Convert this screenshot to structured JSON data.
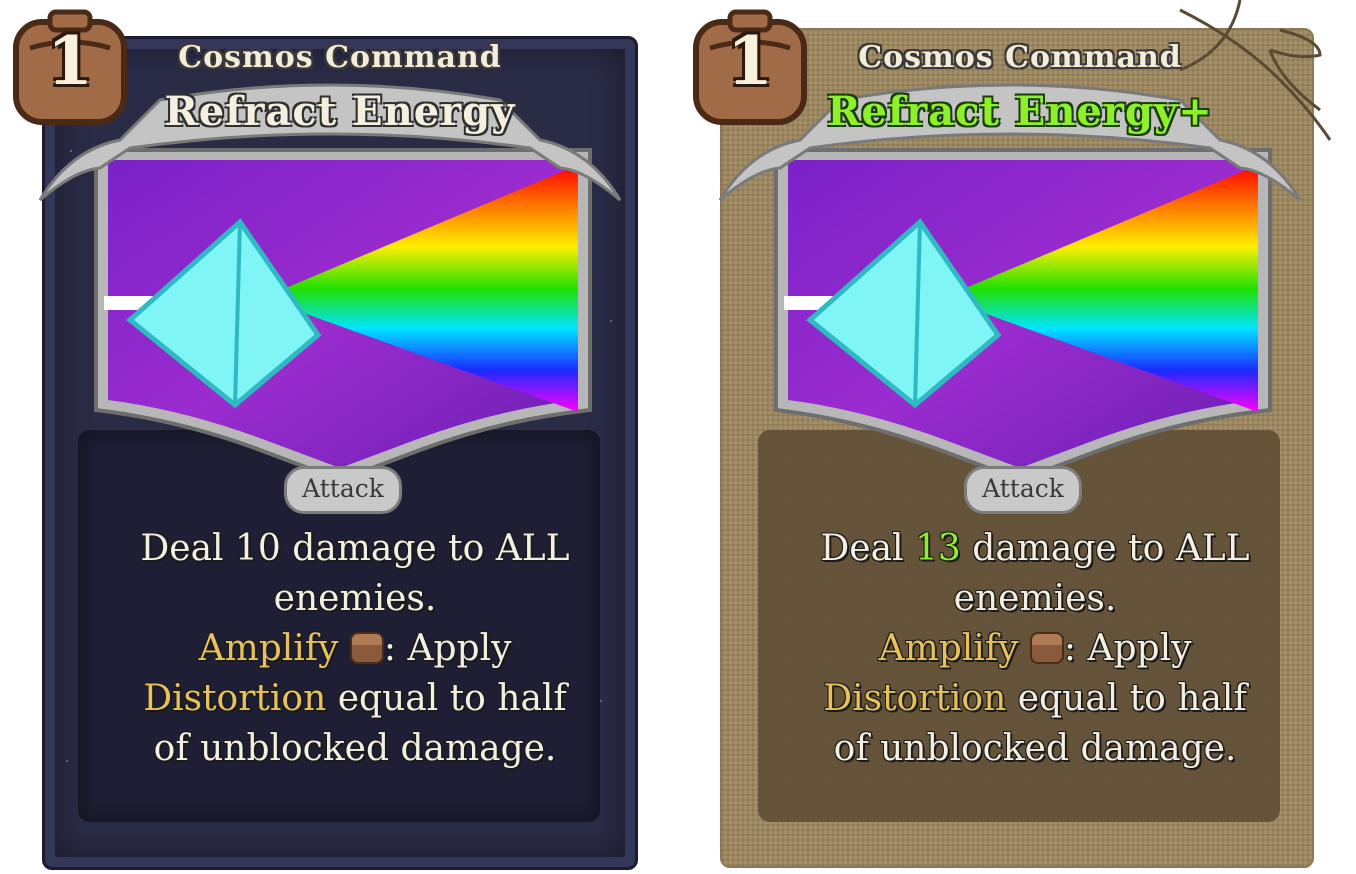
{
  "cards": [
    {
      "variant": "base",
      "cost": "1",
      "type_line": "Cosmos Command",
      "title": "Refract Energy",
      "card_kind": "Attack",
      "desc": {
        "line1_pre": "Deal ",
        "damage": "10",
        "line1_post": " damage to ALL",
        "line2": "enemies.",
        "amplify": "Amplify",
        "apply": ": Apply",
        "distortion": "Distortion",
        "rest1": " equal to half",
        "rest2": "of unblocked damage."
      }
    },
    {
      "variant": "upgraded",
      "cost": "1",
      "type_line": "Cosmos Command",
      "title": "Refract Energy+",
      "card_kind": "Attack",
      "desc": {
        "line1_pre": "Deal ",
        "damage": "13",
        "line1_post": " damage to ALL",
        "line2": "enemies.",
        "amplify": "Amplify",
        "apply": ": Apply",
        "distortion": "Distortion",
        "rest1": " equal to half",
        "rest2": "of unblocked damage."
      }
    }
  ],
  "icons": {
    "cost": "cost-badge-icon",
    "amplify": "satchel-icon",
    "art": "prism-rainbow-art",
    "twine": "twine-bow-icon"
  },
  "colors": {
    "keyword": "#e7c15a",
    "upgrade": "#8ef02a",
    "art_purple": "#8b2fd1"
  }
}
